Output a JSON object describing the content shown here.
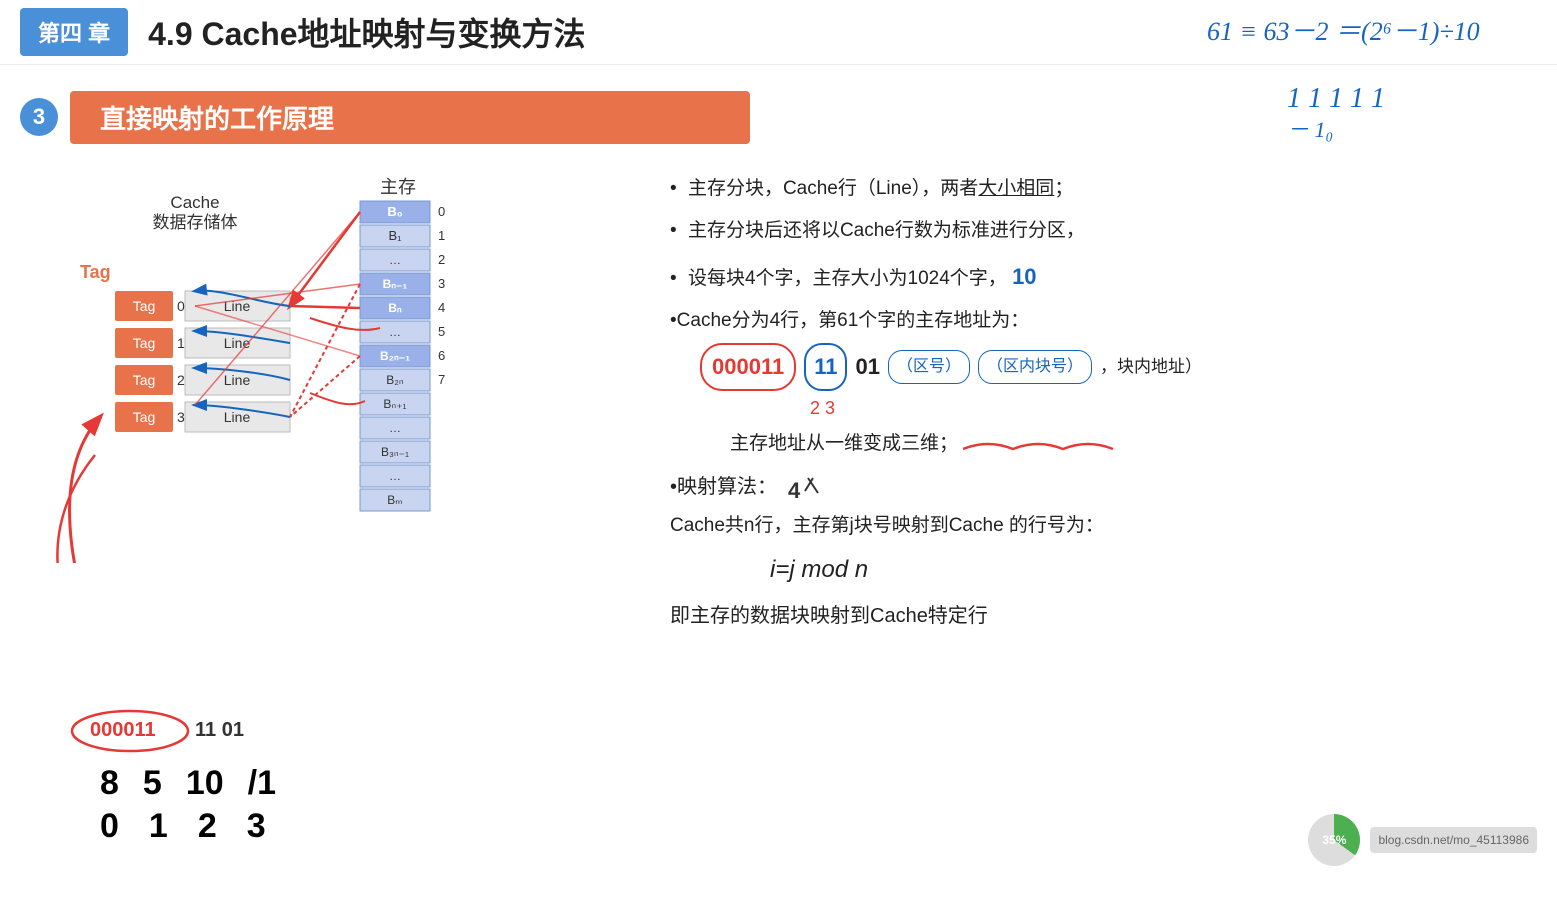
{
  "header": {
    "chapter_label": "第四 章",
    "title": "4.9 Cache地址映射与变换方法",
    "formula_annotation": "61 ≡ 63－2 ＝(2⁶－1)÷10"
  },
  "section": {
    "number": "3",
    "title": "直接映射的工作原理"
  },
  "bullets": [
    "主存分块，Cache行（Line），两者大小相同；",
    "主存分块后还将以Cache行数为标准进行分区，",
    "设每块4个字，主存大小为1024个字，10",
    "Cache分为4行，第61个字的主存地址为："
  ],
  "address_example": {
    "bits_red": "000011",
    "bits_normal": "11  01",
    "labels": [
      "（区号）",
      "（区内块号）",
      "，块内地址）"
    ]
  },
  "address_note": "主存地址从一维变成三维；",
  "mapping_algo": {
    "label": "•映射算法：",
    "description": "Cache共n行，主存第j块号映射到Cache 的行号为：",
    "formula": "i=j mod n",
    "conclusion": "即主存的数据块映射到Cache特定行"
  },
  "cache_diagram": {
    "tag_label": "Tag",
    "cache_label_line1": "Cache",
    "cache_label_line2": "数据存储体",
    "memory_label": "主存",
    "rows": [
      {
        "tag": "Tag",
        "num": "0",
        "line": "Line"
      },
      {
        "tag": "Tag",
        "num": "1",
        "line": "Line"
      },
      {
        "tag": "Tag",
        "num": "2",
        "line": "Line"
      },
      {
        "tag": "Tag",
        "num": "3",
        "line": "Line"
      }
    ],
    "memory_blocks": [
      {
        "label": "B₀",
        "num": "0"
      },
      {
        "label": "B₁",
        "num": "1"
      },
      {
        "label": "…",
        "num": "2"
      },
      {
        "label": "Bₙ₋₁",
        "num": "3"
      },
      {
        "label": "Bₙ",
        "num": "4"
      },
      {
        "label": "…",
        "num": "5"
      },
      {
        "label": "B₂ₙ₋₁",
        "num": "6"
      },
      {
        "label": "B₂ₙ",
        "num": "7"
      },
      {
        "label": "Bₙ₊₁",
        "num": ""
      },
      {
        "label": "…",
        "num": ""
      },
      {
        "label": "B₃ₙ₋₁",
        "num": ""
      },
      {
        "label": "…",
        "num": ""
      },
      {
        "label": "Bₘ",
        "num": ""
      }
    ]
  },
  "bottom_annotation": "000011  11  01",
  "bottom_numbers_row1": "8  5  10  /1",
  "bottom_numbers_row2": "0    1    2    3",
  "progress": {
    "percent": "35%",
    "watermark": "blog.csdn.net/mo_45113986"
  }
}
